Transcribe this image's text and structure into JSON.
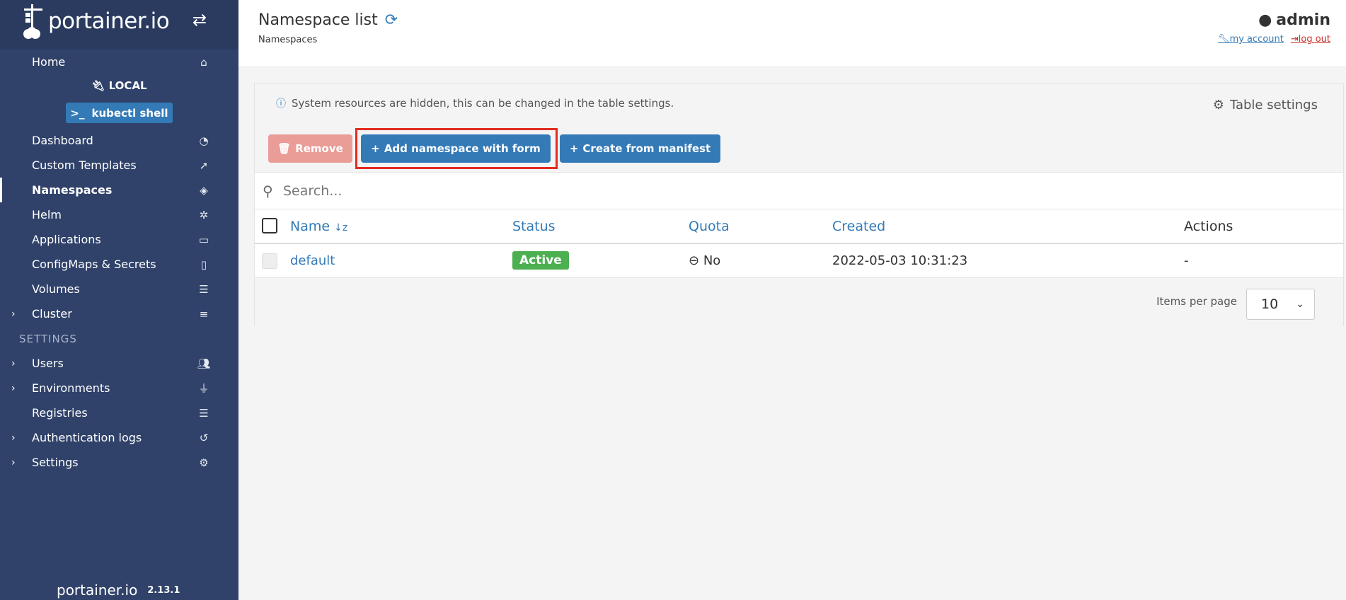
{
  "brand": {
    "logo_text": "portainer.io",
    "version": "2.13.1"
  },
  "sidebar": {
    "home": "Home",
    "environment": "LOCAL",
    "kubectl": "kubectl shell",
    "items": [
      {
        "label": "Dashboard",
        "icon": "tachometer-icon"
      },
      {
        "label": "Custom Templates",
        "icon": "rocket-icon"
      },
      {
        "label": "Namespaces",
        "icon": "layers-icon"
      },
      {
        "label": "Helm",
        "icon": "helm-icon"
      },
      {
        "label": "Applications",
        "icon": "laptop-code-icon"
      },
      {
        "label": "ConfigMaps & Secrets",
        "icon": "file-code-icon"
      },
      {
        "label": "Volumes",
        "icon": "database-icon"
      },
      {
        "label": "Cluster",
        "icon": "server-icon"
      }
    ],
    "settings_title": "SETTINGS",
    "settings_items": [
      {
        "label": "Users",
        "icon": "users-icon"
      },
      {
        "label": "Environments",
        "icon": "plug-icon"
      },
      {
        "label": "Registries",
        "icon": "database-icon"
      },
      {
        "label": "Authentication logs",
        "icon": "history-icon"
      },
      {
        "label": "Settings",
        "icon": "cogs-icon"
      }
    ]
  },
  "header": {
    "title": "Namespace list",
    "breadcrumb": "Namespaces",
    "user": "admin",
    "my_account": "my account",
    "log_out": "log out"
  },
  "widget": {
    "info": "System resources are hidden, this can be changed in the table settings.",
    "table_settings": "Table settings",
    "remove": "Remove",
    "add_form": "Add namespace with form",
    "create_manifest": "Create from manifest",
    "search_placeholder": "Search...",
    "columns": [
      "Name",
      "Status",
      "Quota",
      "Created",
      "Actions"
    ],
    "rows": [
      {
        "name": "default",
        "status": "Active",
        "quota": "No",
        "created": "2022-05-03 10:31:23",
        "actions": "-"
      }
    ],
    "items_per_page_label": "Items per page",
    "items_per_page": "10"
  },
  "colors": {
    "sidebar": "#30426a",
    "primary": "#337ab7",
    "danger_light": "#ea9c97",
    "success": "#4caf50",
    "highlight": "#e22b20"
  }
}
